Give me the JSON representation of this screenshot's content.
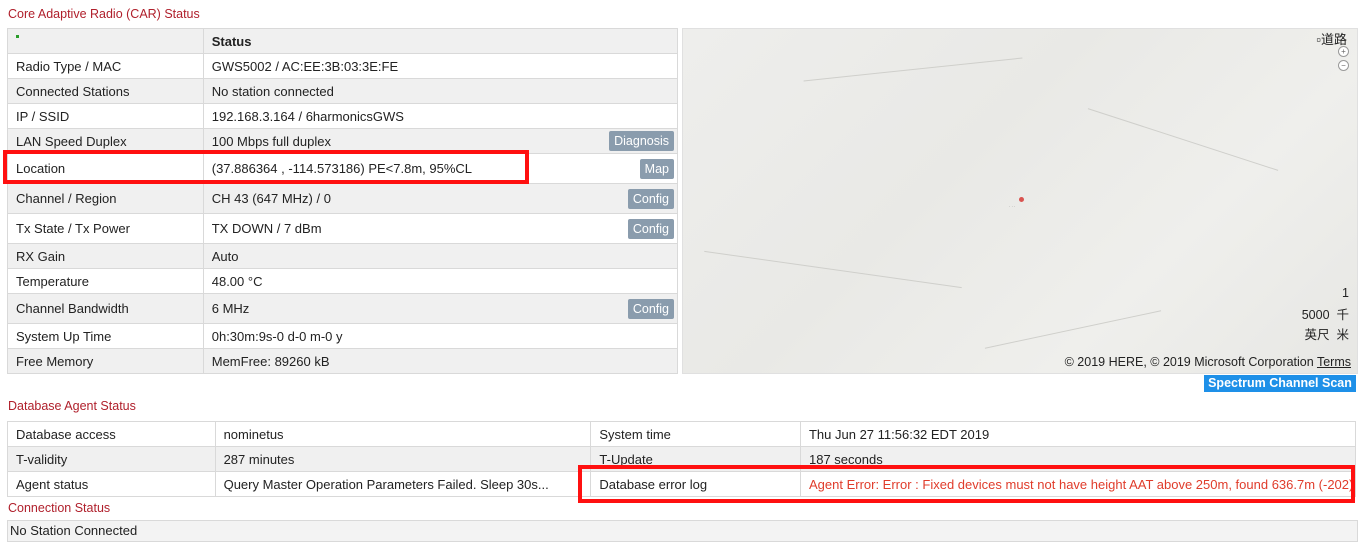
{
  "car": {
    "title": "Core Adaptive Radio (CAR) Status",
    "header_value": "Status",
    "rows": [
      {
        "label": "Radio Type / MAC",
        "value": "GWS5002 / AC:EE:3B:03:3E:FE"
      },
      {
        "label": "Connected Stations",
        "value": "No station connected"
      },
      {
        "label": "IP / SSID",
        "value": "192.168.3.164 / 6harmonicsGWS"
      },
      {
        "label": "LAN Speed Duplex",
        "value": "100 Mbps full duplex",
        "button": "Diagnosis"
      },
      {
        "label": "Location",
        "value": "(37.886364 , -114.573186) PE<7.8m, 95%CL",
        "button": "Map"
      },
      {
        "label": "Channel / Region",
        "value": "CH 43 (647 MHz) / 0",
        "button": "Config"
      },
      {
        "label": "Tx State / Tx Power",
        "value": "TX DOWN / 7 dBm",
        "button": "Config"
      },
      {
        "label": "RX Gain",
        "value": "Auto"
      },
      {
        "label": "Temperature",
        "value": "48.00 °C"
      },
      {
        "label": "Channel Bandwidth",
        "value": "6 MHz",
        "button": "Config"
      },
      {
        "label": "System Up Time",
        "value": "0h:30m:9s-0 d-0 m-0 y"
      },
      {
        "label": "Free Memory",
        "value": "MemFree: 89260 kB"
      }
    ]
  },
  "map": {
    "mode_label": "道路",
    "zoom_in": "+",
    "zoom_out": "−",
    "scale_top": "1",
    "scale_mid": "5000  千",
    "scale_bottom": "英尺  米",
    "copyright": "© 2019 HERE, © 2019 Microsoft Corporation",
    "terms": "Terms"
  },
  "spectrum_button": "Spectrum Channel Scan",
  "db": {
    "title": "Database Agent Status",
    "rows": [
      {
        "l1": "Database access",
        "v1": "nominetus",
        "l2": "System time",
        "v2": "Thu Jun 27 11:56:32 EDT 2019"
      },
      {
        "l1": "T-validity",
        "v1": "287 minutes",
        "l2": "T-Update",
        "v2": "187 seconds"
      },
      {
        "l1": "Agent status",
        "v1": "Query Master Operation Parameters Failed. Sleep 30s...",
        "l2": "Database error log",
        "v2": "Agent Error: Error : Fixed devices must not have height AAT above 250m, found 636.7m (-202)"
      }
    ]
  },
  "connection": {
    "title": "Connection Status",
    "value": "No Station Connected"
  },
  "colors": {
    "section_title": "#b0202c",
    "button_gray": "#8a9cad",
    "spectrum_blue": "#1e90e8",
    "error_red": "#e03c2b",
    "highlight_red": "#ff1010"
  }
}
